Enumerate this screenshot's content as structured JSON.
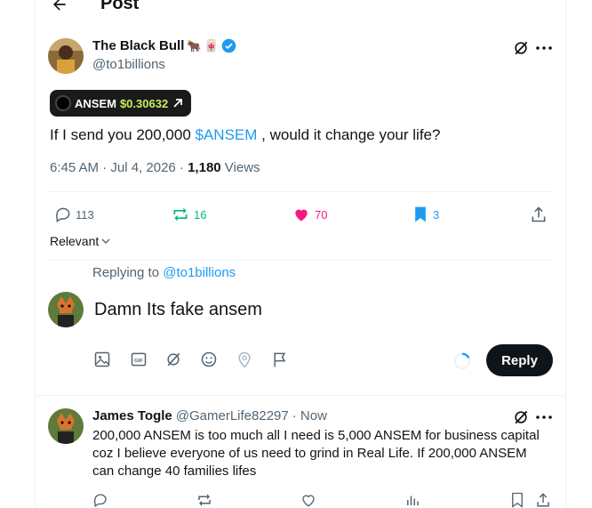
{
  "header": {
    "title": "Post"
  },
  "tweet": {
    "author_name": "The Black Bull",
    "author_handle": "@to1billions",
    "ticker_symbol": "ANSEM",
    "ticker_price": "$0.30632",
    "text_before": "If I send you 200,000 ",
    "cashtag": "$ANSEM",
    "text_after": " , would it change your life?",
    "time": "6:45 AM · Jul 4, 2026 · ",
    "views_count": "1,180",
    "views_label": " Views",
    "replies": "113",
    "reposts": "16",
    "likes": "70",
    "bookmarks": "3"
  },
  "sort": {
    "label": "Relevant"
  },
  "composer": {
    "replying_to_label": "Replying to ",
    "replying_to_handle": "@to1billions",
    "draft": "Damn Its fake ansem",
    "reply_button": "Reply"
  },
  "reply": {
    "name": "James Togle",
    "handle": "@GamerLife82297",
    "time": "· Now",
    "text": "200,000 ANSEM is too much all I need is 5,000 ANSEM for business capital coz I believe everyone of us need to grind in Real Life. If 200,000 ANSEM can change 40 families lifes"
  },
  "colors": {
    "accent": "#1d9bf0",
    "repost": "#00ba7c",
    "like": "#f91880",
    "text": "#0f1419",
    "muted": "#536471"
  }
}
